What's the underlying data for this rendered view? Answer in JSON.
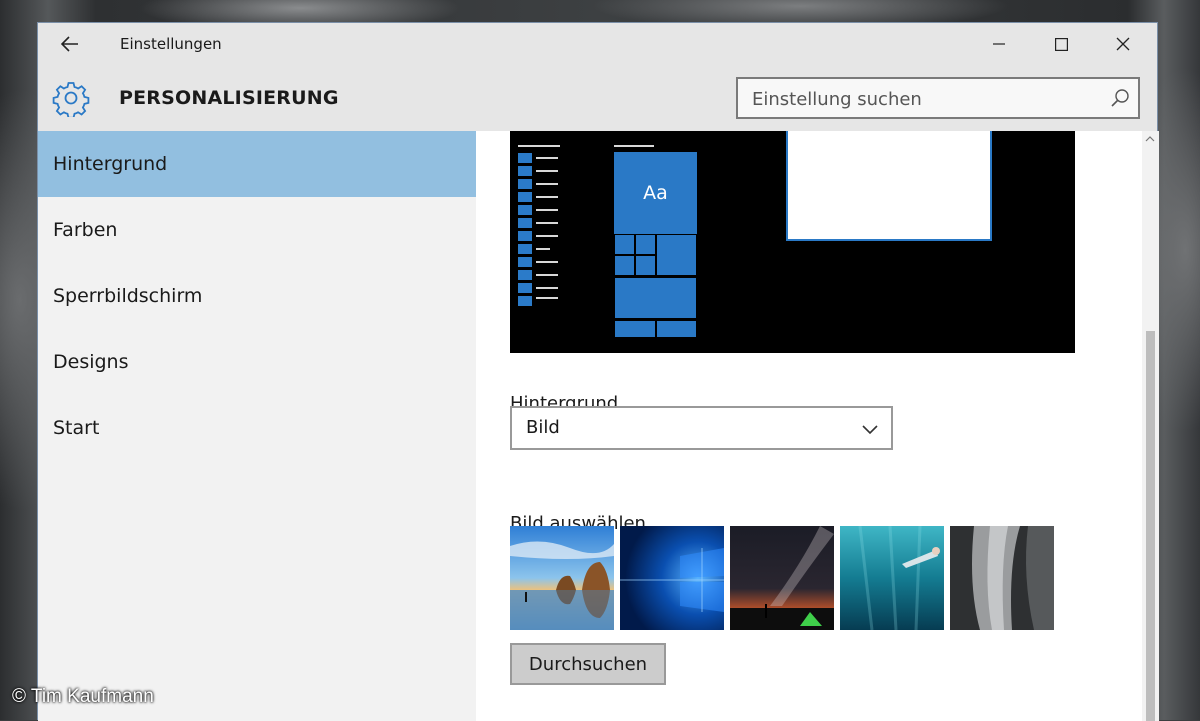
{
  "window": {
    "title": "Einstellungen",
    "min_symbol": "—",
    "max_symbol": "☐",
    "close_symbol": "✕"
  },
  "header": {
    "page_title": "PERSONALISIERUNG",
    "search_placeholder": "Einstellung suchen",
    "icon": "gear-icon"
  },
  "sidebar": {
    "items": [
      {
        "label": "Hintergrund",
        "active": true
      },
      {
        "label": "Farben",
        "active": false
      },
      {
        "label": "Sperrbildschirm",
        "active": false
      },
      {
        "label": "Designs",
        "active": false
      },
      {
        "label": "Start",
        "active": false
      }
    ]
  },
  "preview": {
    "tile_text": "Aa"
  },
  "background": {
    "label": "Hintergrund",
    "selected": "Bild"
  },
  "pictures": {
    "label": "Bild auswählen",
    "thumbnails": [
      "beach-rocks",
      "windows-logo",
      "milky-way-tent",
      "underwater-swimmer",
      "rock-cliff"
    ],
    "browse_label": "Durchsuchen"
  },
  "watermark": "© Tim Kaufmann",
  "colors": {
    "accent": "#2a79c6",
    "active_nav": "#92bfe0"
  }
}
